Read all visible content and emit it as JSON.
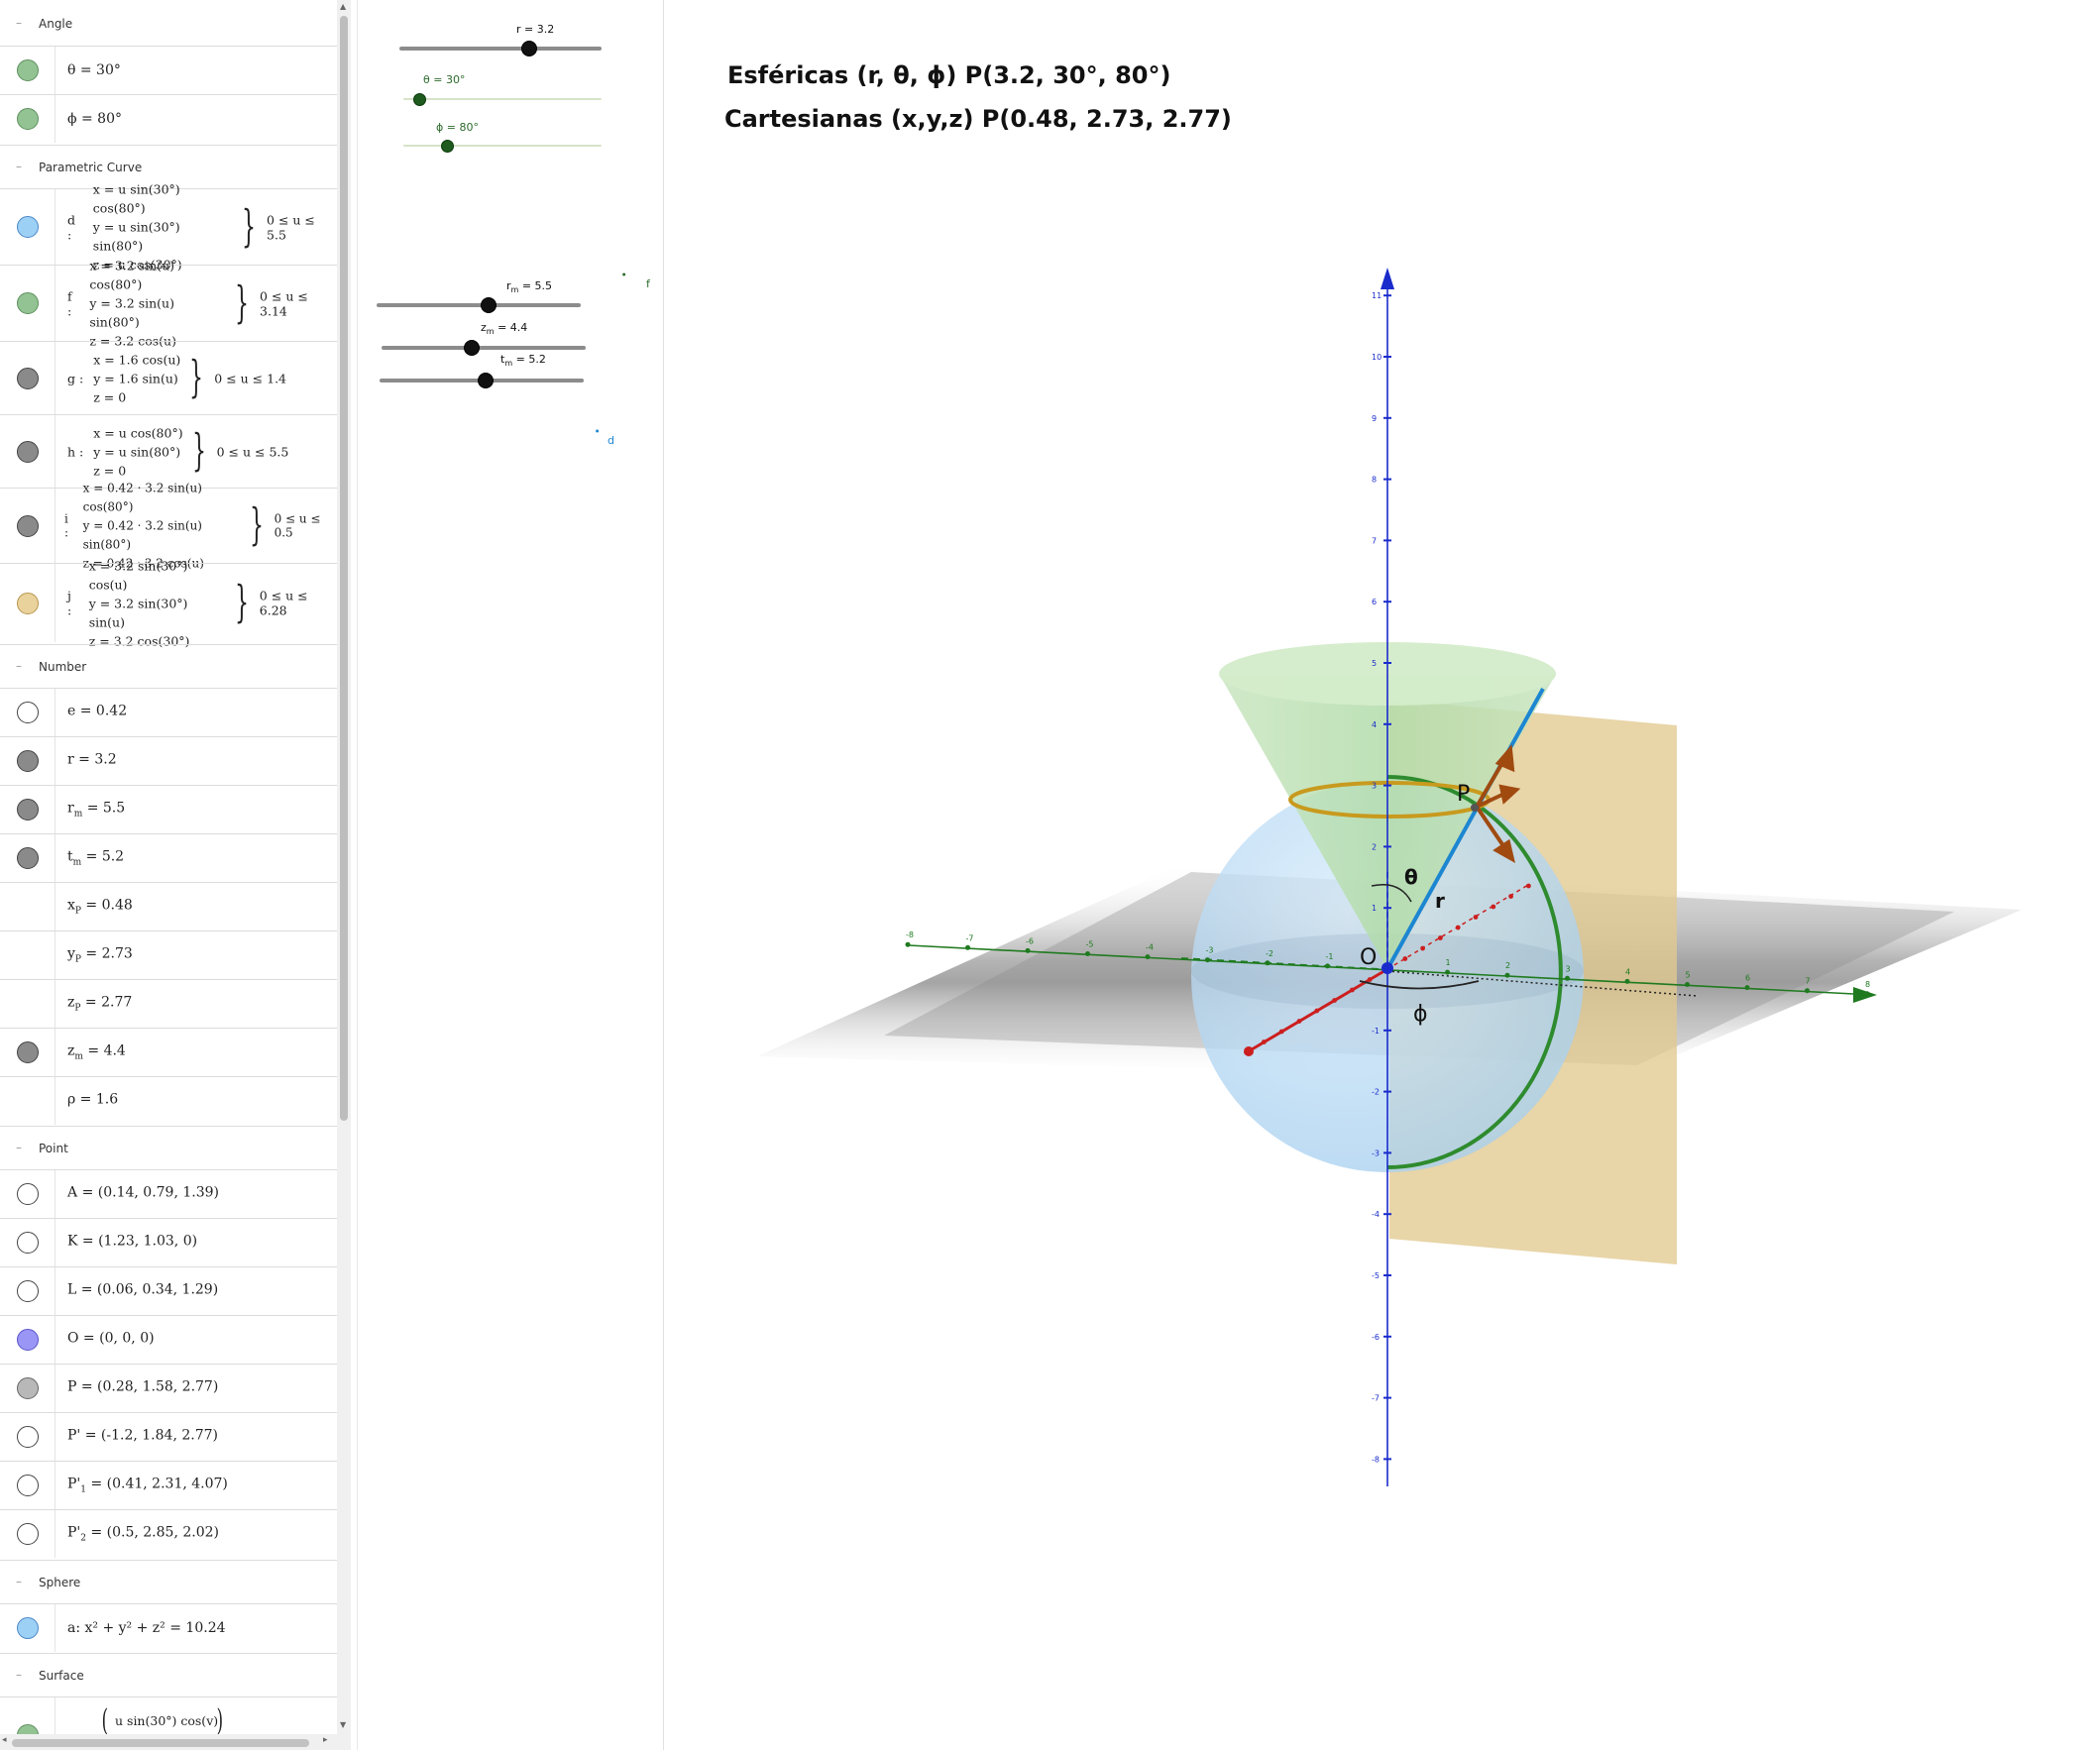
{
  "algebra": {
    "sections": {
      "angle": "Angle",
      "parametric": "Parametric Curve",
      "number": "Number",
      "point": "Point",
      "sphere": "Sphere",
      "surface": "Surface"
    },
    "toggle_glyph": "–",
    "angles": [
      {
        "expr": "θ = 30°",
        "color": "#93c393"
      },
      {
        "expr": "ϕ = 80°",
        "color": "#93c393"
      }
    ],
    "curves": {
      "d": {
        "name": "d :",
        "x": "x = u  sin(30°)  cos(80°)",
        "y": "y = u  sin(30°)  sin(80°)",
        "z": "z = u  cos(30°)",
        "range": "0 ≤ u ≤ 5.5"
      },
      "f": {
        "name": "f :",
        "x": "x = 3.2  sin(u)  cos(80°)",
        "y": "y = 3.2  sin(u)  sin(80°)",
        "z": "z = 3.2  cos(u)",
        "range": "0 ≤ u ≤ 3.14"
      },
      "g": {
        "name": "g :",
        "x": "x = 1.6  cos(u)",
        "y": "y = 1.6  sin(u)",
        "z": "z = 0",
        "range": "0 ≤ u ≤ 1.4"
      },
      "h": {
        "name": "h :",
        "x": "x = u  cos(80°)",
        "y": "y = u  sin(80°)",
        "z": "z = 0",
        "range": "0 ≤ u ≤ 5.5"
      },
      "i": {
        "name": "i :",
        "x": "x = 0.42 · 3.2  sin(u)  cos(80°)",
        "y": "y = 0.42 · 3.2  sin(u)  sin(80°)",
        "z": "z = 0.42 · 3.2  cos(u)",
        "range": "0 ≤ u ≤ 0.5"
      },
      "j": {
        "name": "j :",
        "x": "x = 3.2  sin(30°)  cos(u)",
        "y": "y = 3.2  sin(30°)  sin(u)",
        "z": "z = 3.2  cos(30°)",
        "range": "0 ≤ u ≤ 6.28"
      }
    },
    "numbers": [
      {
        "name": "e",
        "sub": "",
        "value": " = 0.42"
      },
      {
        "name": "r",
        "sub": "",
        "value": " = 3.2"
      },
      {
        "name": "r",
        "sub": "m",
        "value": " = 5.5"
      },
      {
        "name": "t",
        "sub": "m",
        "value": " = 5.2"
      },
      {
        "name": "x",
        "sub": "P",
        "value": " = 0.48"
      },
      {
        "name": "y",
        "sub": "P",
        "value": " = 2.73"
      },
      {
        "name": "z",
        "sub": "P",
        "value": " = 2.77"
      },
      {
        "name": "z",
        "sub": "m",
        "value": " = 4.4"
      },
      {
        "name": "ρ",
        "sub": "",
        "value": " = 1.6"
      }
    ],
    "points": [
      {
        "name": "A",
        "sub": "",
        "value": " = (0.14, 0.79, 1.39)"
      },
      {
        "name": "K",
        "sub": "",
        "value": " = (1.23, 1.03, 0)"
      },
      {
        "name": "L",
        "sub": "",
        "value": " = (0.06, 0.34, 1.29)"
      },
      {
        "name": "O",
        "sub": "",
        "value": " = (0, 0, 0)"
      },
      {
        "name": "P",
        "sub": "",
        "value": " = (0.28, 1.58, 2.77)"
      },
      {
        "name": "P'",
        "sub": "",
        "value": " = (-1.2, 1.84, 2.77)"
      },
      {
        "name": "P'",
        "sub": "1",
        "value": " = (0.41, 2.31, 4.07)"
      },
      {
        "name": "P'",
        "sub": "2",
        "value": " = (0.5, 2.85, 2.02)"
      }
    ],
    "sphere": {
      "expr": "a: x² + y² + z² = 10.24"
    },
    "surface": {
      "line1": "u  sin(30°)  cos(v)"
    }
  },
  "sliders": {
    "r": {
      "label": "r = 3.2",
      "value": 3.2,
      "min": 0,
      "max": 5
    },
    "theta": {
      "label": "θ = 30°",
      "value": 30,
      "min": 0,
      "max": 360
    },
    "phi": {
      "label": "ϕ = 80°",
      "value": 80,
      "min": 0,
      "max": 360
    },
    "rm": {
      "label_main": "r",
      "label_sub": "m",
      "label_rest": " = 5.5",
      "value": 5.5,
      "min": 0,
      "max": 10
    },
    "zm": {
      "label_main": "z",
      "label_sub": "m",
      "label_rest": " = 4.4",
      "value": 4.4,
      "min": 0,
      "max": 10
    },
    "tm": {
      "label_main": "t",
      "label_sub": "m",
      "label_rest": " = 5.2",
      "value": 5.2,
      "min": 0,
      "max": 10
    },
    "f_label": "f",
    "d_label": "d"
  },
  "view3d": {
    "spherical": "Esféricas  (r, θ, ϕ)  P(3.2, 30°, 80°)",
    "cartesian": "Cartesianas  (x,y,z)  P(0.48, 2.73, 2.77)",
    "labels": {
      "P": "P",
      "O": "O",
      "theta": "θ",
      "phi": "ϕ",
      "r": "r"
    },
    "z_ticks": [
      "11",
      "10",
      "9",
      "8",
      "7",
      "6",
      "5",
      "4",
      "3",
      "2",
      "1",
      "-1",
      "-2",
      "-3",
      "-4",
      "-5",
      "-6",
      "-7",
      "-8"
    ],
    "y_ticks": [
      "-8",
      "-7",
      "-6",
      "-5",
      "-4",
      "-3",
      "-2",
      "-1",
      "1",
      "2",
      "3",
      "4",
      "5",
      "6",
      "7",
      "8"
    ],
    "colors": {
      "z_axis": "#1a2bcc",
      "y_axis": "#1f7a1f",
      "x_axis": "#cc1f1f",
      "sphere": "#a8d0f0",
      "cone": "#b9ddb0",
      "plane": "#e2c98f",
      "ring": "#c89a1e",
      "meridian": "#2e8b2e",
      "radius": "#1d86d1",
      "vectors": "#a04a10"
    }
  }
}
